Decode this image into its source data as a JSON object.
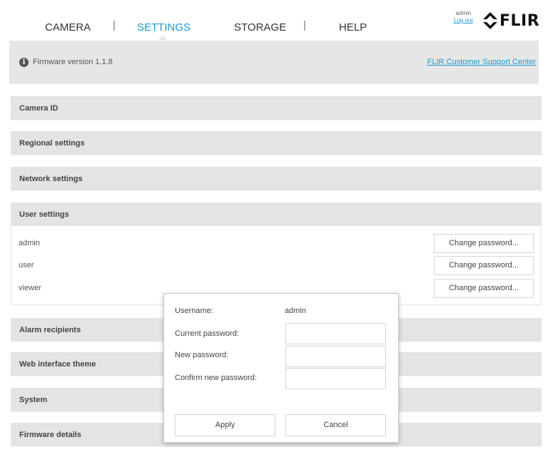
{
  "nav": {
    "items": [
      {
        "label": "CAMERA",
        "active": false
      },
      {
        "label": "SETTINGS",
        "active": true
      },
      {
        "label": "STORAGE",
        "active": false
      },
      {
        "label": "HELP",
        "active": false
      }
    ],
    "separator": "|"
  },
  "user": {
    "name": "admin",
    "logout_label": "Log out"
  },
  "logo": {
    "text": "FLIR",
    "icon": "flir-diamond-icon"
  },
  "firmware": {
    "text": "Firmware version 1.1.8",
    "info_icon": "i",
    "support_link": "FLIR Customer Support Center"
  },
  "sections": {
    "camera_id": "Camera ID",
    "regional": "Regional settings",
    "network": "Network settings",
    "user_settings": "User settings",
    "alarm": "Alarm recipients",
    "theme": "Web interface theme",
    "system": "System",
    "firmware_details": "Firmware details"
  },
  "users": [
    {
      "name": "admin",
      "button": "Change password..."
    },
    {
      "name": "user",
      "button": "Change password..."
    },
    {
      "name": "viewer",
      "button": "Change password..."
    }
  ],
  "dialog": {
    "username_label": "Username:",
    "username_value": "admin",
    "current_label": "Current password:",
    "new_label": "New password:",
    "confirm_label": "Confirm new password:",
    "current_value": "",
    "new_value": "",
    "confirm_value": "",
    "apply": "Apply",
    "cancel": "Cancel"
  },
  "colors": {
    "accent": "#1a9ad6",
    "panel": "#e4e4e4"
  }
}
